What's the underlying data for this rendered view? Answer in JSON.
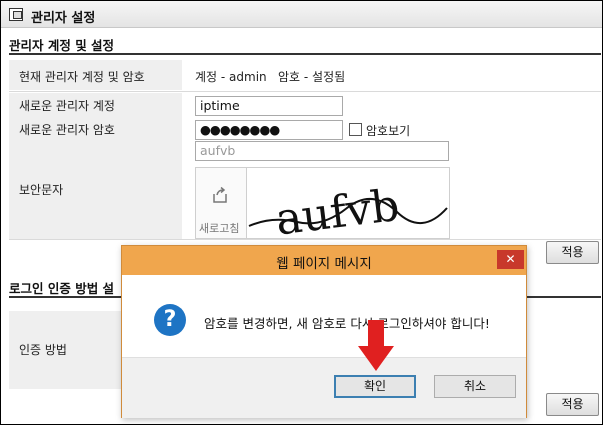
{
  "header": {
    "title": "관리자 설정"
  },
  "account_section": {
    "title": "관리자 계정 및 설정",
    "current": {
      "label": "현재 관리자 계정 및 암호",
      "account_text": "계정 - admin",
      "password_text": "암호 - 설정됨"
    },
    "new_account": {
      "label": "새로운 관리자 계정",
      "value": "iptime"
    },
    "new_password": {
      "label": "새로운 관리자 암호",
      "masked_value": "●●●●●●●●",
      "show_label": "암호보기"
    },
    "captcha": {
      "label": "보안문자",
      "input_value": "aufvb",
      "refresh_label": "새로고침",
      "image_text": "aufvb"
    },
    "apply_label": "적용"
  },
  "login_section": {
    "title": "로그인 인증 방법 설",
    "method_label": "인증 방법",
    "apply_label": "적용"
  },
  "dialog": {
    "title": "웹 페이지 메시지",
    "close_glyph": "✕",
    "message": "암호를 변경하면, 새 암호로 다시 로그인하셔야 합니다!",
    "question_glyph": "?",
    "ok_label": "확인",
    "cancel_label": "취소"
  },
  "colors": {
    "dialog_titlebar": "#f0a64d",
    "close_button": "#c8382b",
    "question_icon": "#1e74c4",
    "annotation_arrow": "#e02020"
  }
}
